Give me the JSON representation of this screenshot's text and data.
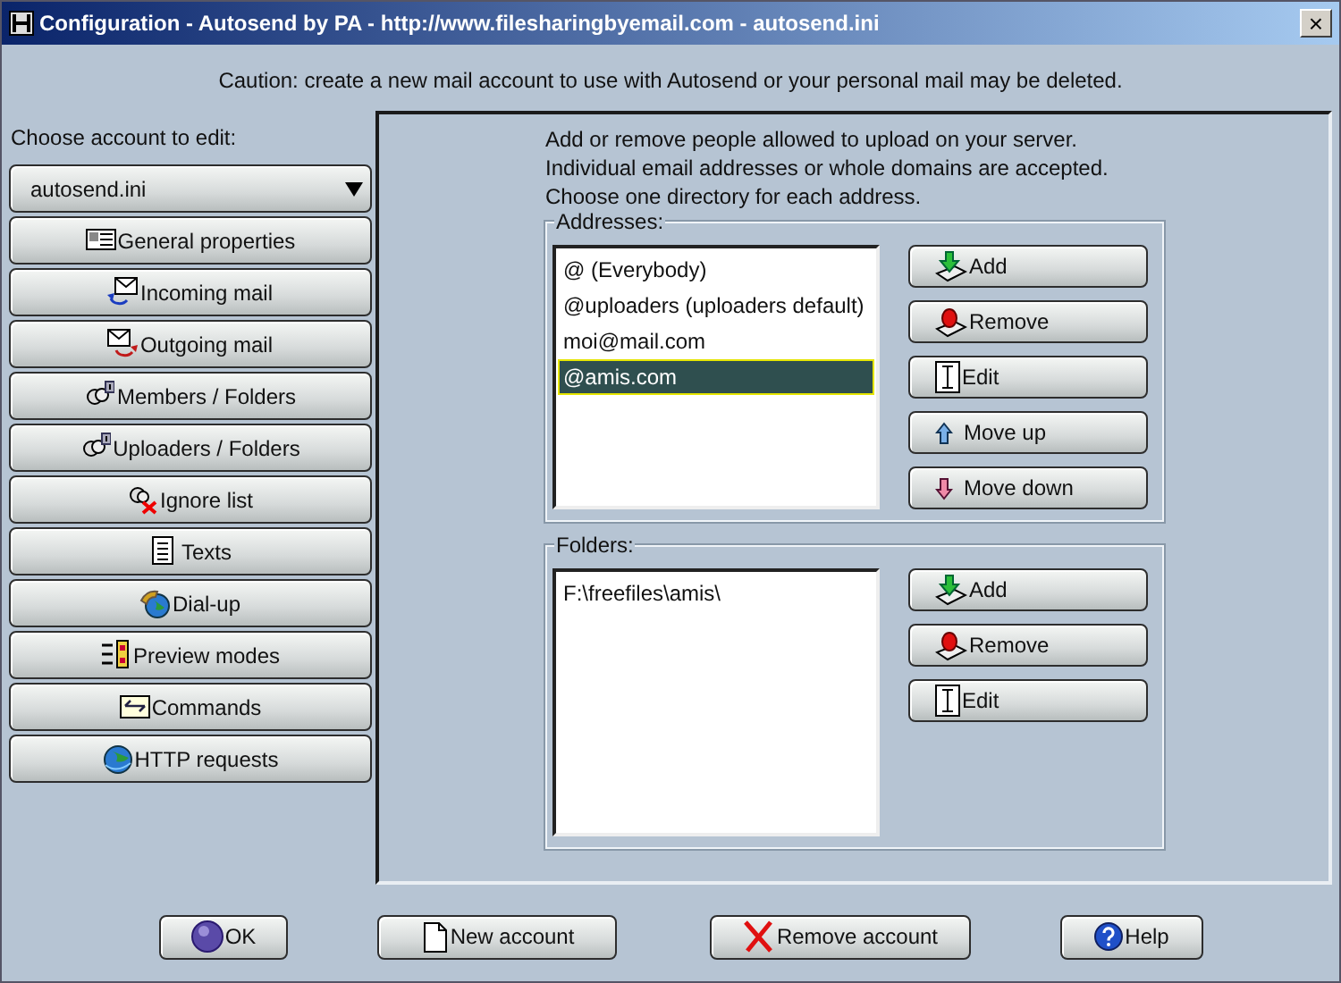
{
  "window": {
    "title": "Configuration - Autosend by PA - http://www.filesharingbyemail.com - autosend.ini",
    "close": "×"
  },
  "caution": "Caution: create a new mail account to use with Autosend or your personal mail may be deleted.",
  "sidebar": {
    "label": "Choose account to edit:",
    "account": "autosend.ini",
    "items": [
      {
        "label": "General properties"
      },
      {
        "label": "Incoming mail"
      },
      {
        "label": "Outgoing mail"
      },
      {
        "label": "Members / Folders"
      },
      {
        "label": "Uploaders / Folders"
      },
      {
        "label": "Ignore list"
      },
      {
        "label": "Texts"
      },
      {
        "label": "Dial-up"
      },
      {
        "label": "Preview modes"
      },
      {
        "label": "Commands"
      },
      {
        "label": "HTTP requests"
      }
    ]
  },
  "intro": [
    "Add or remove people allowed to upload on your server.",
    "Individual email addresses or whole domains are accepted.",
    "Choose one directory for each address."
  ],
  "addresses": {
    "legend": "Addresses:",
    "items": [
      {
        "text": "@ (Everybody)",
        "selected": false
      },
      {
        "text": "@uploaders (uploaders default)",
        "selected": false
      },
      {
        "text": "moi@mail.com",
        "selected": false
      },
      {
        "text": "@amis.com",
        "selected": true
      }
    ],
    "buttons": [
      {
        "kind": "add",
        "label": "Add"
      },
      {
        "kind": "remove",
        "label": "Remove"
      },
      {
        "kind": "edit",
        "label": "Edit"
      },
      {
        "kind": "up",
        "label": "Move up"
      },
      {
        "kind": "down",
        "label": "Move down"
      }
    ]
  },
  "folders": {
    "legend": "Folders:",
    "items": [
      {
        "text": "F:\\freefiles\\amis\\",
        "selected": false
      }
    ],
    "buttons": [
      {
        "kind": "add",
        "label": "Add"
      },
      {
        "kind": "remove",
        "label": "Remove"
      },
      {
        "kind": "edit",
        "label": "Edit"
      }
    ]
  },
  "footer": [
    {
      "kind": "ok",
      "label": "OK"
    },
    {
      "kind": "new",
      "label": "New account"
    },
    {
      "kind": "delete",
      "label": "Remove account"
    },
    {
      "kind": "help",
      "label": "Help"
    }
  ]
}
